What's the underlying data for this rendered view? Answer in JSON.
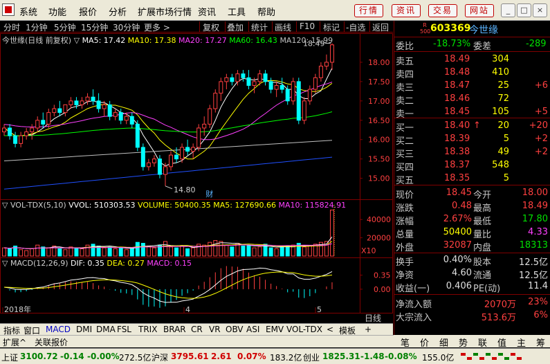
{
  "menu": {
    "items": [
      "系统",
      "功能",
      "报价",
      "分析",
      "扩展市场行情",
      "资讯",
      "工具",
      "帮助"
    ],
    "quick_buttons": [
      "行情",
      "资讯",
      "交易",
      "网站"
    ],
    "window_buttons": [
      "_",
      "□",
      "×"
    ]
  },
  "toolbar": {
    "left": [
      "分时",
      "1分钟",
      "5分钟",
      "15分钟",
      "30分钟",
      "更多 >"
    ],
    "right": [
      "复权",
      "叠加",
      "统计",
      "画线",
      "F10",
      "标记",
      "-自选",
      "返回"
    ]
  },
  "chart_data": [
    {
      "type": "candlestick",
      "title": "今世缘(日线 前复权)",
      "ma_labels": [
        {
          "text": "MA5: 17.42",
          "color": "#ffffff"
        },
        {
          "text": "MA10: 17.38",
          "color": "#ffff00"
        },
        {
          "text": "MA20: 17.27",
          "color": "#ff40ff"
        },
        {
          "text": "MA60: 16.43",
          "color": "#00ff00"
        },
        {
          "text": "MA120: 15.99",
          "color": "#c0c0c0"
        }
      ],
      "ylim": [
        14.6,
        18.5
      ],
      "yticks": [
        "18.00",
        "17.50",
        "17.00",
        "16.50",
        "16.00",
        "15.50",
        "15.00"
      ],
      "max_label": "18.49",
      "min_label": "14.80",
      "annotation": "财",
      "x_labels": [
        "2018年",
        "4",
        "5"
      ],
      "candles": [
        [
          16.2,
          16.4,
          16.1,
          16.3
        ],
        [
          16.3,
          16.4,
          16.0,
          16.1
        ],
        [
          16.1,
          16.2,
          15.8,
          15.9
        ],
        [
          15.9,
          16.2,
          15.8,
          16.1
        ],
        [
          16.1,
          16.3,
          16.0,
          16.2
        ],
        [
          16.2,
          16.4,
          16.0,
          16.3
        ],
        [
          16.3,
          16.6,
          16.2,
          16.5
        ],
        [
          16.5,
          16.7,
          16.3,
          16.4
        ],
        [
          16.4,
          16.8,
          16.3,
          16.7
        ],
        [
          16.7,
          16.9,
          16.6,
          16.8
        ],
        [
          16.8,
          17.0,
          16.6,
          16.7
        ],
        [
          16.7,
          16.9,
          16.6,
          16.9
        ],
        [
          16.9,
          17.1,
          16.8,
          17.0
        ],
        [
          17.0,
          17.1,
          16.8,
          16.9
        ],
        [
          16.9,
          17.1,
          16.8,
          17.0
        ],
        [
          17.0,
          17.2,
          16.9,
          17.1
        ],
        [
          17.1,
          17.3,
          16.9,
          17.0
        ],
        [
          17.0,
          17.2,
          16.7,
          16.8
        ],
        [
          16.8,
          17.0,
          16.6,
          16.9
        ],
        [
          16.9,
          17.0,
          16.5,
          16.6
        ],
        [
          16.6,
          16.8,
          16.5,
          16.7
        ],
        [
          16.7,
          16.8,
          16.4,
          16.5
        ],
        [
          16.5,
          16.7,
          16.4,
          16.6
        ],
        [
          16.6,
          16.7,
          16.3,
          16.4
        ],
        [
          16.4,
          16.5,
          15.7,
          15.8
        ],
        [
          15.8,
          15.9,
          15.2,
          15.3
        ],
        [
          15.3,
          15.5,
          15.2,
          15.4
        ],
        [
          15.4,
          15.6,
          15.3,
          15.5
        ],
        [
          15.5,
          15.6,
          15.0,
          15.1
        ],
        [
          15.1,
          15.4,
          14.8,
          15.3
        ],
        [
          15.3,
          15.7,
          15.2,
          15.6
        ],
        [
          15.6,
          15.8,
          15.4,
          15.5
        ],
        [
          15.5,
          15.9,
          15.4,
          15.8
        ],
        [
          15.8,
          16.0,
          15.6,
          15.7
        ],
        [
          15.7,
          15.9,
          15.5,
          15.8
        ],
        [
          15.8,
          16.4,
          15.7,
          16.3
        ],
        [
          16.3,
          16.6,
          16.1,
          16.4
        ],
        [
          16.4,
          16.9,
          16.3,
          16.8
        ],
        [
          16.8,
          17.3,
          16.7,
          17.2
        ],
        [
          17.2,
          17.6,
          17.0,
          17.5
        ],
        [
          17.5,
          17.7,
          17.3,
          17.6
        ],
        [
          17.6,
          17.7,
          17.4,
          17.5
        ],
        [
          17.5,
          17.8,
          17.4,
          17.7
        ],
        [
          17.7,
          17.8,
          17.5,
          17.6
        ],
        [
          17.6,
          17.8,
          17.3,
          17.4
        ],
        [
          17.4,
          17.6,
          17.2,
          17.5
        ],
        [
          17.5,
          17.8,
          17.4,
          17.7
        ],
        [
          17.7,
          17.8,
          17.4,
          17.5
        ],
        [
          17.5,
          17.6,
          17.2,
          17.3
        ],
        [
          17.3,
          17.5,
          17.1,
          17.4
        ],
        [
          17.4,
          17.6,
          17.2,
          17.3
        ],
        [
          17.3,
          17.4,
          16.9,
          17.0
        ],
        [
          17.0,
          17.6,
          16.9,
          17.5
        ],
        [
          17.5,
          17.6,
          16.4,
          16.5
        ],
        [
          16.5,
          17.1,
          16.4,
          17.0
        ],
        [
          17.0,
          17.4,
          16.9,
          17.3
        ],
        [
          17.3,
          17.7,
          17.2,
          17.6
        ],
        [
          17.6,
          18.0,
          17.5,
          17.9
        ],
        [
          17.9,
          18.2,
          17.8,
          18.0
        ],
        [
          18.0,
          18.49,
          17.8,
          18.45
        ]
      ]
    },
    {
      "type": "bar",
      "title": "VOL-TDX(5,10)",
      "labels": [
        {
          "text": "VVOL: 510303.53",
          "color": "#ffffff"
        },
        {
          "text": "VOLUME: 50400.35",
          "color": "#ffff00"
        },
        {
          "text": "MA5: 127690.66",
          "color": "#ffff00"
        },
        {
          "text": "MA10: 115824.91",
          "color": "#ff40ff"
        }
      ],
      "yticks": [
        "40000",
        "20000"
      ],
      "unit_label": "X10",
      "ylim": [
        0,
        50000
      ],
      "values": [
        9000,
        8000,
        11000,
        7000,
        6000,
        8000,
        12000,
        10000,
        9000,
        11000,
        8000,
        7000,
        10000,
        9000,
        8000,
        12000,
        13000,
        11000,
        9000,
        10000,
        8000,
        9000,
        7000,
        8000,
        15000,
        14000,
        11000,
        9000,
        12000,
        16000,
        10000,
        9000,
        11000,
        8000,
        9000,
        13000,
        12000,
        15000,
        17000,
        16000,
        12000,
        10000,
        14000,
        11000,
        12000,
        9000,
        10000,
        13000,
        9000,
        8000,
        10000,
        11000,
        12000,
        14000,
        10000,
        11000,
        13000,
        15000,
        16000,
        50400
      ]
    },
    {
      "type": "line",
      "title": "MACD(12,26,9)",
      "labels": [
        {
          "text": "DIF: 0.35",
          "color": "#ffffff"
        },
        {
          "text": "DEA: 0.27",
          "color": "#ffff00"
        },
        {
          "text": "MACD: 0.15",
          "color": "#ff40ff"
        }
      ],
      "yticks": [
        "0.35",
        "0.00"
      ],
      "ylim": [
        -0.45,
        0.55
      ]
    }
  ],
  "quote": {
    "logo_top": "R",
    "logo_bottom": "500",
    "code": "603369",
    "name": "今世缘",
    "committee_ratio_label": "委比",
    "committee_ratio": "-18.73%",
    "committee_diff_label": "委差",
    "committee_diff": "-289",
    "asks": [
      {
        "label": "卖五",
        "price": "18.49",
        "volume": "304",
        "change": ""
      },
      {
        "label": "卖四",
        "price": "18.48",
        "volume": "410",
        "change": ""
      },
      {
        "label": "卖三",
        "price": "18.47",
        "volume": "25",
        "change": "+6"
      },
      {
        "label": "卖二",
        "price": "18.46",
        "volume": "72",
        "change": ""
      },
      {
        "label": "卖一",
        "price": "18.45",
        "volume": "105",
        "change": "+5"
      }
    ],
    "bids": [
      {
        "label": "买一",
        "price": "18.40",
        "arrow": "↑",
        "volume": "20",
        "change": "+20"
      },
      {
        "label": "买二",
        "price": "18.39",
        "arrow": "",
        "volume": "5",
        "change": "+2"
      },
      {
        "label": "买三",
        "price": "18.38",
        "arrow": "",
        "volume": "49",
        "change": "+2"
      },
      {
        "label": "买四",
        "price": "18.37",
        "arrow": "",
        "volume": "548",
        "change": ""
      },
      {
        "label": "买五",
        "price": "18.35",
        "arrow": "",
        "volume": "5",
        "change": ""
      }
    ],
    "stats": [
      {
        "l1": "现价",
        "v1": "18.45",
        "c1": "red",
        "l2": "今开",
        "v2": "18.00",
        "c2": "red"
      },
      {
        "l1": "涨跌",
        "v1": "0.48",
        "c1": "red",
        "l2": "最高",
        "v2": "18.49",
        "c2": "red"
      },
      {
        "l1": "涨幅",
        "v1": "2.67%",
        "c1": "red",
        "l2": "最低",
        "v2": "17.80",
        "c2": "green"
      },
      {
        "l1": "总量",
        "v1": "50400",
        "c1": "yellow",
        "l2": "量比",
        "v2": "4.33",
        "c2": "magenta"
      },
      {
        "l1": "外盘",
        "v1": "32087",
        "c1": "red",
        "l2": "内盘",
        "v2": "18313",
        "c2": "green"
      }
    ],
    "fund": [
      {
        "l1": "换手",
        "v1": "0.40%",
        "l2": "股本",
        "v2": "12.5亿"
      },
      {
        "l1": "净资",
        "v1": "4.60",
        "l2": "流通",
        "v2": "12.5亿"
      },
      {
        "l1": "收益(一)",
        "v1": "0.406",
        "l2": "PE(动)",
        "v2": "11.4"
      }
    ],
    "flows": [
      {
        "label": "净流入额",
        "value": "2070万",
        "pct": "23%"
      },
      {
        "label": "大宗流入",
        "value": "513.6万",
        "pct": "6%"
      }
    ]
  },
  "bottom_tabs": [
    "指标",
    "窗口",
    "MACD",
    "DMI",
    "DMA",
    "FSL",
    "TRIX",
    "BRAR",
    "CR",
    "VR",
    "OBV",
    "ASI",
    "EMV",
    "VOL-TDX",
    "<",
    "模板",
    "+",
    "日线"
  ],
  "bottom_tabs2": [
    "扩展^",
    "关联报价"
  ],
  "right_tabs": [
    "笔",
    "价",
    "细",
    "势",
    "联",
    "值",
    "主",
    "筹"
  ],
  "status": [
    {
      "text": "上证",
      "cls": "dark"
    },
    {
      "text": "3100.72",
      "cls": "green"
    },
    {
      "text": "-0.14",
      "cls": "green"
    },
    {
      "text": "-0.00%",
      "cls": "green"
    },
    {
      "text": "272.5亿",
      "cls": "dark"
    },
    {
      "text": "沪深",
      "cls": "dark"
    },
    {
      "text": "3795.61",
      "cls": "red"
    },
    {
      "text": "2.61",
      "cls": "red"
    },
    {
      "text": "0.07%",
      "cls": "red"
    },
    {
      "text": "183.2亿",
      "cls": "dark"
    },
    {
      "text": "创业",
      "cls": "dark"
    },
    {
      "text": "1825.31",
      "cls": "green"
    },
    {
      "text": "-1.48",
      "cls": "green"
    },
    {
      "text": "-0.08%",
      "cls": "green"
    },
    {
      "text": "155.0亿",
      "cls": "dark"
    }
  ],
  "colors": {
    "up": "#ff4040",
    "down": "#00ffff",
    "border": "#800000",
    "ma5": "#ffffff",
    "ma10": "#ffff00",
    "ma20": "#ff40ff",
    "ma60": "#00ff00",
    "ma120": "#c0c0c0",
    "ma250": "#2050ff"
  }
}
